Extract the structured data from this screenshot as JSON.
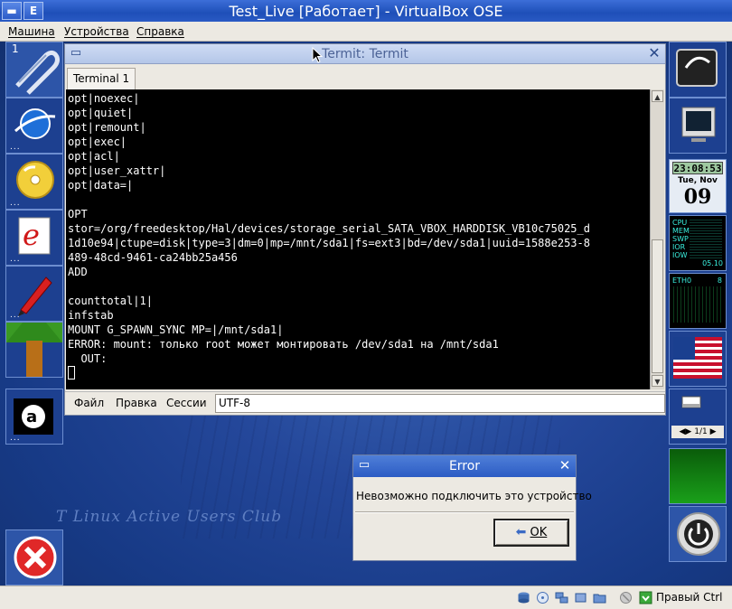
{
  "vbox": {
    "title": "Test_Live [Работает] - VirtualBox OSE",
    "menu": [
      "Машина",
      "Устройства",
      "Справка"
    ],
    "host_key": "Правый Ctrl"
  },
  "left_dock": {
    "desktop_number": "1",
    "dots": "..."
  },
  "right_dock": {
    "clock_time": "23:08:53",
    "date_weekday": "Tue, Nov",
    "date_day": "09",
    "sysmon_labels": [
      "CPU",
      "MEM",
      "SWP",
      "IOR",
      "IOW"
    ],
    "sysmon_value": "05.10",
    "net_label": "ETH0",
    "net_value": "8",
    "pager_text": "1/1"
  },
  "termit": {
    "title": "Termit: Termit",
    "tab_label": "Terminal 1",
    "lines": [
      "opt|noexec|",
      "opt|quiet|",
      "opt|remount|",
      "opt|exec|",
      "opt|acl|",
      "opt|user_xattr|",
      "opt|data=|",
      "",
      "OPT",
      "stor=/org/freedesktop/Hal/devices/storage_serial_SATA_VBOX_HARDDISK_VB10c75025_d",
      "1d10e94|ctupe=disk|type=3|dm=0|mp=/mnt/sda1|fs=ext3|bd=/dev/sda1|uuid=1588e253-8",
      "489-48cd-9461-ca24bb25a456",
      "ADD",
      "",
      "counttotal|1|",
      "infstab",
      "MOUNT G_SPAWN_SYNC MP=|/mnt/sda1|",
      "ERROR: mount: только root может монтировать /dev/sda1 на /mnt/sda1",
      "  OUT:"
    ],
    "menu": [
      "Файл",
      "Правка",
      "Сессии"
    ],
    "encoding": "UTF-8"
  },
  "error_dialog": {
    "title": "Error",
    "message": "Невозможно подключить это устройство",
    "ok_label": "OK"
  },
  "wallpaper_text": "T Linux Active Users Club"
}
